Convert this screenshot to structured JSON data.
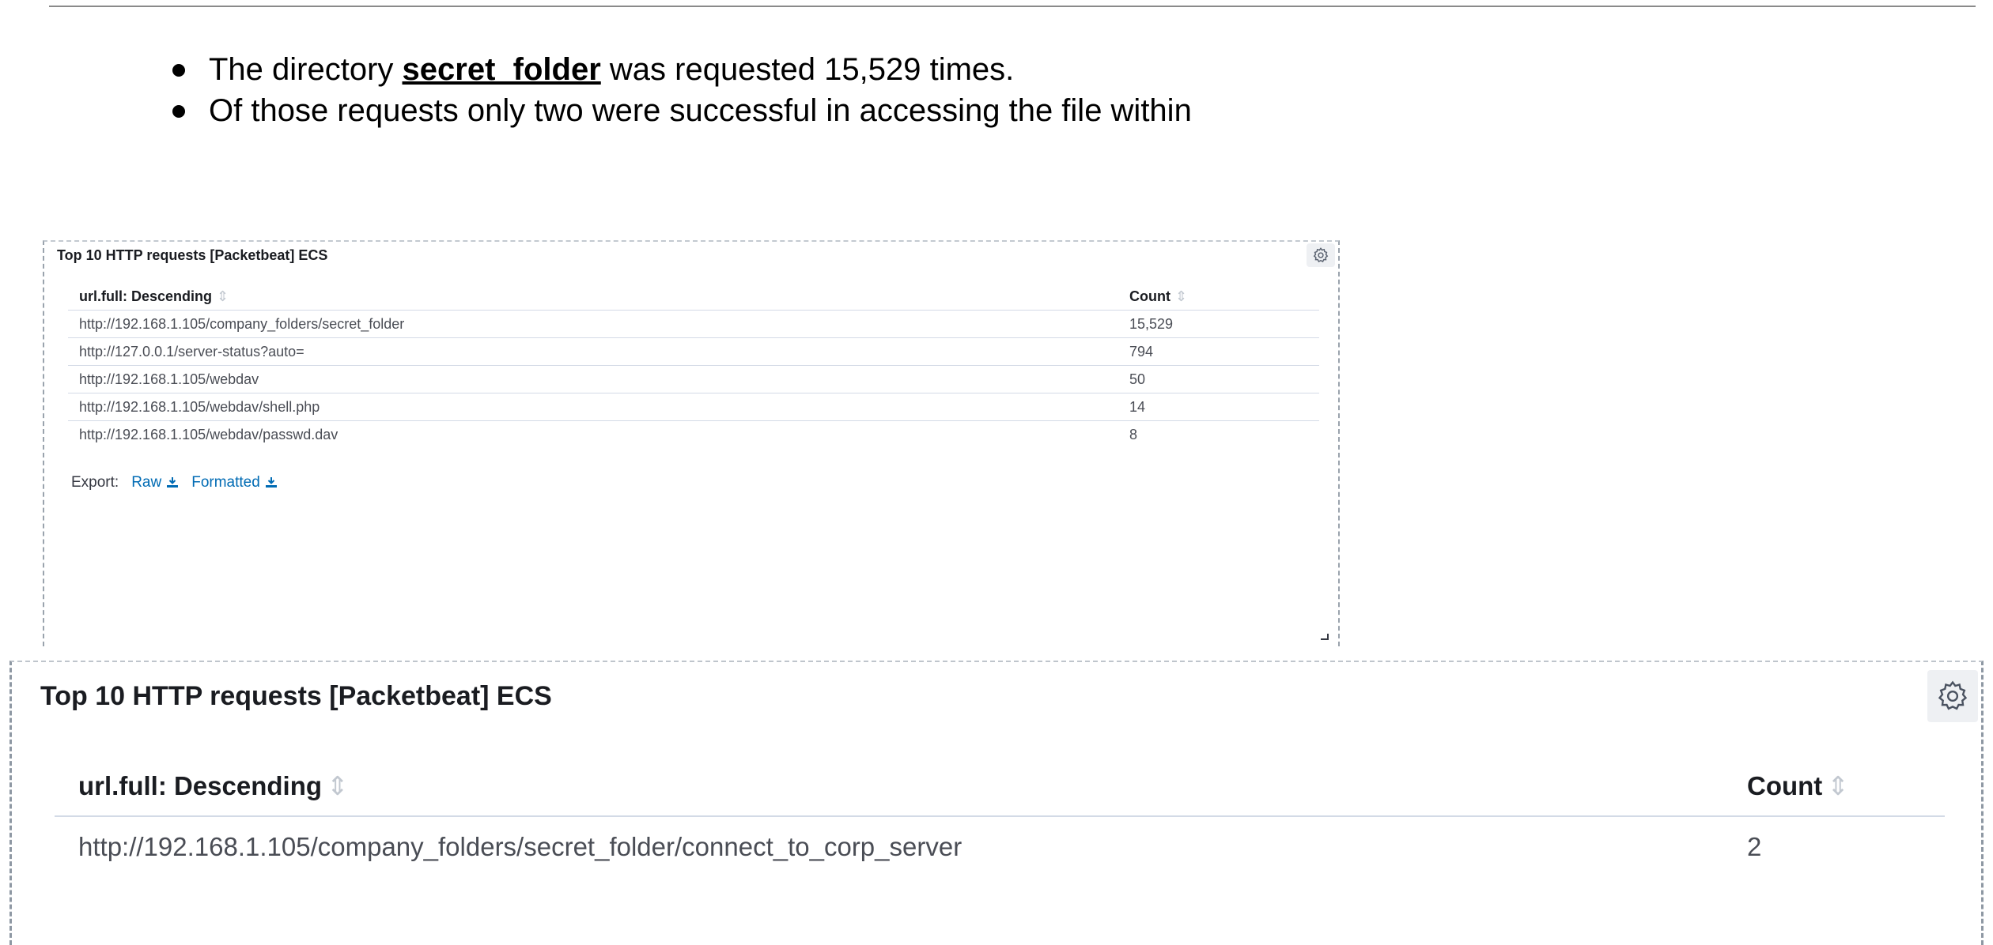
{
  "bullets": {
    "item1": {
      "before": "The directory ",
      "highlight": "secret_folder",
      "after": " was requested 15,529 times."
    },
    "item2": "Of those requests only two were successful in accessing the file within"
  },
  "panel_small": {
    "title": "Top 10 HTTP requests [Packetbeat] ECS",
    "columns": [
      "url.full: Descending",
      "Count"
    ],
    "rows": [
      {
        "url": "http://192.168.1.105/company_folders/secret_folder",
        "count": "15,529"
      },
      {
        "url": "http://127.0.0.1/server-status?auto=",
        "count": "794"
      },
      {
        "url": "http://192.168.1.105/webdav",
        "count": "50"
      },
      {
        "url": "http://192.168.1.105/webdav/shell.php",
        "count": "14"
      },
      {
        "url": "http://192.168.1.105/webdav/passwd.dav",
        "count": "8"
      }
    ],
    "export_label": "Export:",
    "export_raw": "Raw",
    "export_formatted": "Formatted",
    "icons": {
      "settings": "gear-icon",
      "download": "download-icon",
      "resize": "resize-handle-icon",
      "sort": "sort-arrows-icon"
    }
  },
  "panel_large": {
    "title": "Top 10 HTTP requests [Packetbeat] ECS",
    "columns": [
      "url.full: Descending",
      "Count"
    ],
    "rows": [
      {
        "url": "http://192.168.1.105/company_folders/secret_folder/connect_to_corp_server",
        "count": "2"
      }
    ]
  },
  "colors": {
    "link": "#006bb4",
    "text": "#343741",
    "border": "#d3dae6"
  }
}
